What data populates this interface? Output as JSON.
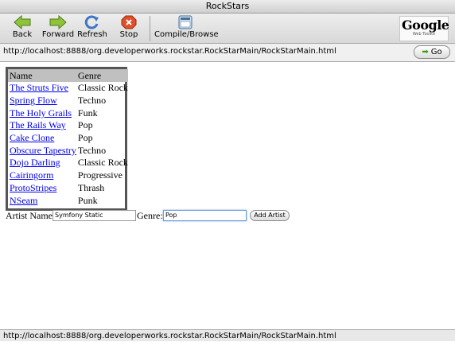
{
  "window": {
    "title": "RockStars"
  },
  "toolbar": {
    "back_label": "Back",
    "forward_label": "Forward",
    "refresh_label": "Refresh",
    "stop_label": "Stop",
    "compile_label": "Compile/Browse",
    "logo_text": "Google",
    "logo_sub": "Web Toolkit"
  },
  "address": {
    "url": "http://localhost:8888/org.developerworks.rockstar.RockStarMain/RockStarMain.html",
    "go_label": "Go"
  },
  "table": {
    "headers": [
      "Name",
      "Genre"
    ],
    "rows": [
      {
        "name": "The Struts Five",
        "genre": "Classic Rock"
      },
      {
        "name": "Spring Flow",
        "genre": "Techno"
      },
      {
        "name": "The Holy Grails",
        "genre": "Funk"
      },
      {
        "name": "The Rails Way",
        "genre": "Pop"
      },
      {
        "name": "Cake Clone",
        "genre": "Pop"
      },
      {
        "name": "Obscure Tapestry",
        "genre": "Techno"
      },
      {
        "name": "Dojo Darling",
        "genre": "Classic Rock"
      },
      {
        "name": "Cairingorm",
        "genre": "Progressive"
      },
      {
        "name": "ProtoStripes",
        "genre": "Thrash"
      },
      {
        "name": "NSeam",
        "genre": "Punk"
      }
    ]
  },
  "form": {
    "artist_label": "Artist Name:",
    "artist_value": "Symfony Static",
    "genre_label": "Genre:",
    "genre_value": "Pop",
    "add_label": "Add Artist"
  },
  "status": {
    "text": "http://localhost:8888/org.developerworks.rockstar.RockStarMain/RockStarMain.html"
  },
  "colors": {
    "link": "#0000ee",
    "table_header": "#c0c0c0",
    "table_border": "#555555"
  }
}
